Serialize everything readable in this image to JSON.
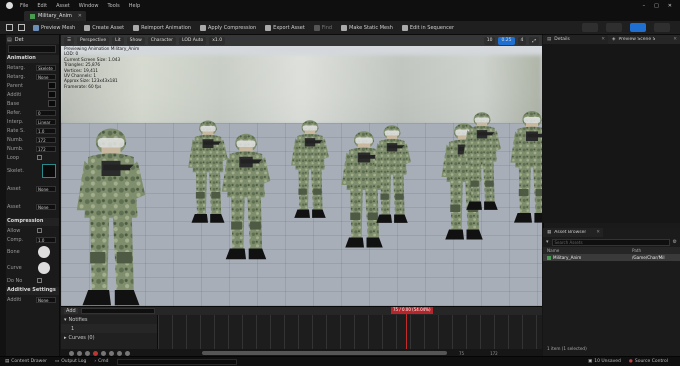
{
  "menu": [
    "File",
    "Edit",
    "Asset",
    "Window",
    "Tools",
    "Help"
  ],
  "document_tab": "Military_Anim",
  "toolbar": {
    "buttons": [
      "Preview Mesh",
      "Create Asset",
      "Reimport Animation",
      "Apply Compression",
      "Export Asset",
      "Find",
      "Make Static Mesh",
      "Edit in Sequencer"
    ]
  },
  "left_panel": {
    "sections": [
      {
        "header": "Animation",
        "rows": [
          {
            "label": "Retarg.",
            "value": "Skelete"
          },
          {
            "label": "Retarg.",
            "value": "None"
          },
          {
            "label": "Parent",
            "value": ""
          },
          {
            "label": "Additi",
            "value": ""
          },
          {
            "label": "Base",
            "value": ""
          },
          {
            "label": "Refer.",
            "value": "0"
          },
          {
            "label": "Interp.",
            "value": "Linear"
          },
          {
            "label": "Rate S.",
            "value": "1.0"
          },
          {
            "label": "Numb.",
            "value": "172"
          },
          {
            "label": "Numb.",
            "value": "172"
          },
          {
            "label": "Loop",
            "value": ""
          },
          {
            "label": "Skelet.",
            "value": ""
          },
          {
            "label": "Asset",
            "value": "None"
          },
          {
            "label": "Asset",
            "value": "None"
          }
        ]
      },
      {
        "header": "Compression",
        "rows": [
          {
            "label": "Allow",
            "value": ""
          },
          {
            "label": "Comp.",
            "value": "1.0"
          },
          {
            "label": "Bone",
            "value": ""
          },
          {
            "label": "Curve",
            "value": ""
          },
          {
            "label": "Do No",
            "value": ""
          }
        ]
      },
      {
        "header": "Additive Settings",
        "rows": [
          {
            "label": "Additi",
            "value": "None"
          }
        ]
      }
    ]
  },
  "viewport": {
    "chips": [
      "Perspective",
      "Lit",
      "Show",
      "Character",
      "LOD Auto",
      "x1.0"
    ],
    "stats": [
      "Previewing Animation Military_Anim",
      "LOD: 0",
      "Current Screen Size: 1.043",
      "Triangles: 25,876",
      "Vertices: 19,411",
      "UV Channels: 1",
      "Approx Size: 123x43x181",
      "Framerate: 60 fps"
    ],
    "right_controls": [
      "10",
      "0.25",
      "4"
    ]
  },
  "right_panel": {
    "details_tab": "Details",
    "preview_tab": "Preview Scene S",
    "asset_browser_tab": "Asset Browser",
    "search_placeholder": "Search Assets",
    "col_name": "Name",
    "col_path": "Path",
    "asset_name": "Military_Anim",
    "asset_path": "/Game/Char/Mil",
    "item_count": "1 item (1 selected)"
  },
  "sequencer": {
    "add_label": "Add",
    "track_label": "Notifies",
    "track_row": "1",
    "curves_label": "Curves (0)",
    "playhead_label": "75 / 0.00 (54.04%)",
    "frame_count": "172",
    "frame_current": "75"
  },
  "statusbar": {
    "left": [
      "Content Drawer",
      "Output Log",
      "Cmd"
    ],
    "right": [
      "10 Unsaved",
      "Source Control"
    ]
  }
}
